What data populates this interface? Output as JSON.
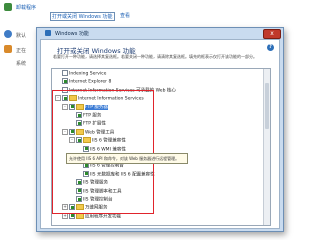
{
  "background": {
    "link1": "卸载程序",
    "link2": "打开或关闭 Windows 功能",
    "link3": "查看",
    "label1": "默认",
    "label2": "正在",
    "label3": "系统"
  },
  "dialog": {
    "title": "Windows 功能",
    "close_label": "x",
    "heading": "打开或关闭 Windows 功能",
    "info_symbol": "?",
    "description": "若要打开一种功能，请选择其复选框。若要关闭一种功能，请清除其复选框。填充的框表示仅打开该功能的一部分。"
  },
  "tree": {
    "rows": [
      {
        "label": "Indexing Service",
        "checked": false,
        "expander": "",
        "folder": false
      },
      {
        "label": "Internet Explorer 8",
        "checked": true,
        "expander": "",
        "folder": false
      },
      {
        "label": "Internet Information Services 可承载的 Web 核心",
        "checked": false,
        "expander": "",
        "folder": false
      },
      {
        "label": "Internet Information Services",
        "checked": true,
        "expander": "-",
        "folder": true
      },
      {
        "label": "FTP 服务器",
        "checked": true,
        "expander": "-",
        "folder": true,
        "selected": true
      },
      {
        "label": "FTP 服务",
        "checked": true,
        "expander": "",
        "folder": false
      },
      {
        "label": "FTP 扩展性",
        "checked": true,
        "expander": "",
        "folder": false
      },
      {
        "label": "Web 管理工具",
        "checked": true,
        "expander": "-",
        "folder": true
      },
      {
        "label": "IIS 6 管理兼容性",
        "checked": true,
        "expander": "-",
        "folder": true
      },
      {
        "label": "IIS 6 WMI 兼容性",
        "checked": true,
        "expander": "",
        "folder": false
      },
      {
        "label": "IIS 6 脚本工具",
        "checked": true,
        "expander": "",
        "folder": false
      },
      {
        "label": "IIS 6 管理控制台",
        "checked": true,
        "expander": "",
        "folder": false
      },
      {
        "label": "IIS 元数据库和 IIS 6 配置兼容性",
        "checked": true,
        "expander": "",
        "folder": false
      },
      {
        "label": "IIS 管理服务",
        "checked": true,
        "expander": "",
        "folder": false
      },
      {
        "label": "IIS 管理脚本和工具",
        "checked": true,
        "expander": "",
        "folder": false
      },
      {
        "label": "IIS 管理控制台",
        "checked": true,
        "expander": "",
        "folder": false
      },
      {
        "label": "万维网服务",
        "checked": true,
        "expander": "+",
        "folder": true
      },
      {
        "label": "应用程序开发功能",
        "checked": true,
        "expander": "+",
        "folder": true
      }
    ]
  },
  "tooltip": {
    "text": "允许使用 IIS 6 API 和命令，对该 Web 服务器进行远程管理。"
  },
  "colors": {
    "highlight_border": "#e0242c",
    "selection": "#3a7bd5"
  }
}
